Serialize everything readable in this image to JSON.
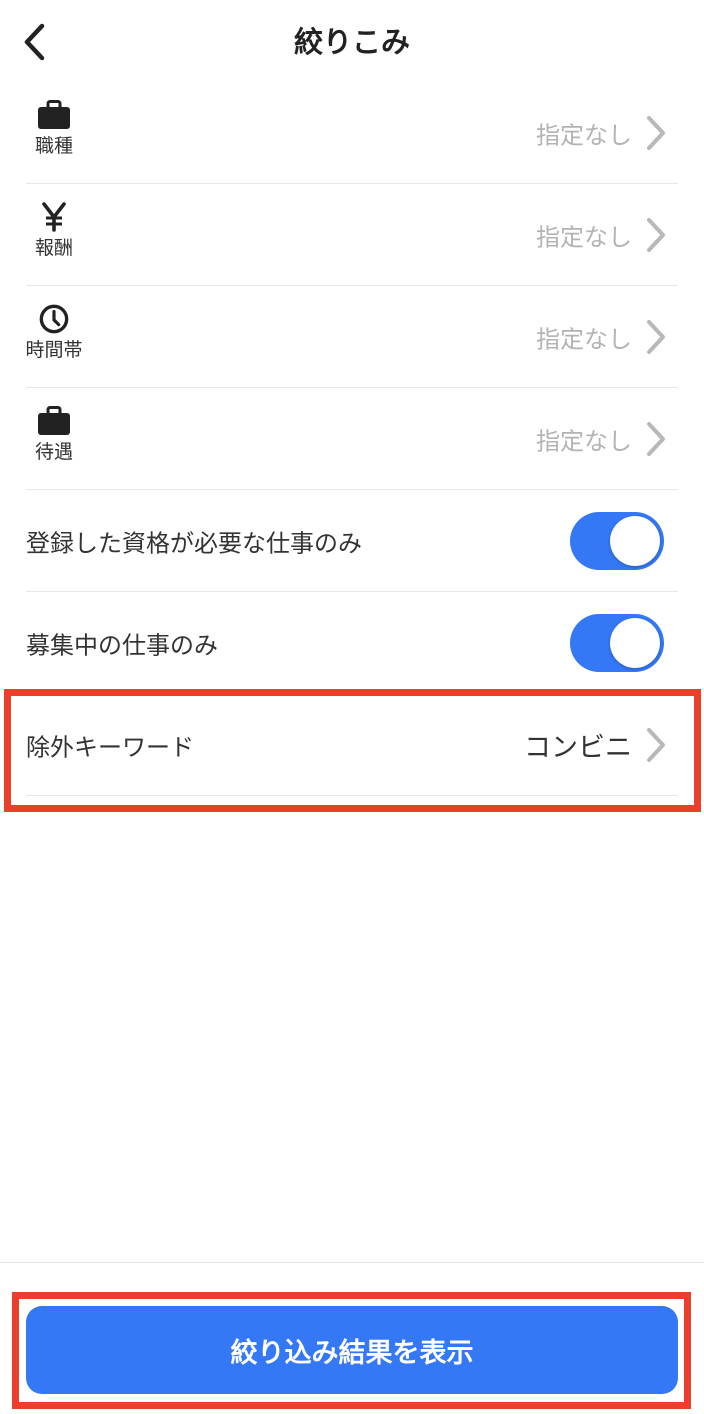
{
  "header": {
    "title": "絞りこみ",
    "back_icon": "chevron-left-icon"
  },
  "filters": [
    {
      "icon": "briefcase-icon",
      "label": "職種",
      "value": "指定なし"
    },
    {
      "icon": "yen-icon",
      "label": "報酬",
      "value": "指定なし"
    },
    {
      "icon": "clock-icon",
      "label": "時間帯",
      "value": "指定なし"
    },
    {
      "icon": "briefcase-icon",
      "label": "待遇",
      "value": "指定なし"
    }
  ],
  "toggles": [
    {
      "label": "登録した資格が必要な仕事のみ",
      "on": true
    },
    {
      "label": "募集中の仕事のみ",
      "on": true
    }
  ],
  "exclude_keyword": {
    "label": "除外キーワード",
    "value": "コンビニ"
  },
  "footer": {
    "submit_label": "絞り込み結果を表示"
  },
  "colors": {
    "accent": "#3478f6",
    "highlight": "#e8402a",
    "muted_text": "#b3b3b3",
    "chevron": "#b8b8b8"
  }
}
